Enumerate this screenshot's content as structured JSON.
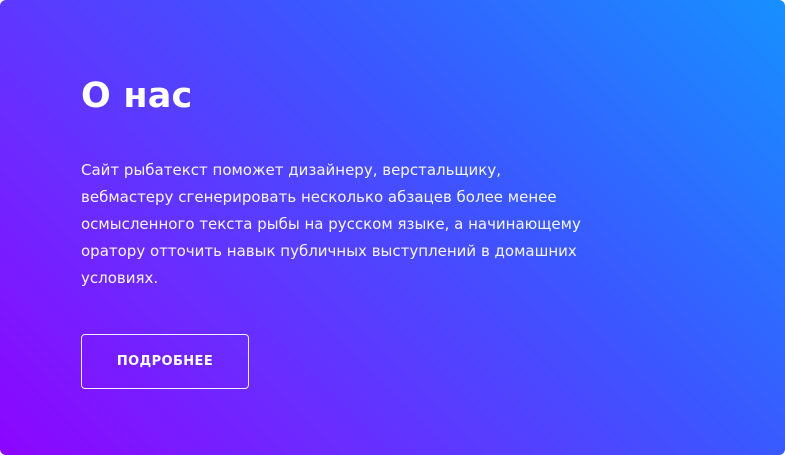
{
  "about": {
    "title": "О нас",
    "description": "Сайт рыбатекст поможет дизайнеру, верстальщику, вебмастеру сгенерировать несколько абзацев более менее осмысленного текста рыбы на русском языке, а начинающему оратору отточить навык публичных выступлений в домашних условиях.",
    "button_label": "ПОДРОБНЕЕ"
  },
  "colors": {
    "gradient_start": "#8c05ff",
    "gradient_mid": "#3a58ff",
    "gradient_end": "#1790ff",
    "text": "#ffffff"
  }
}
